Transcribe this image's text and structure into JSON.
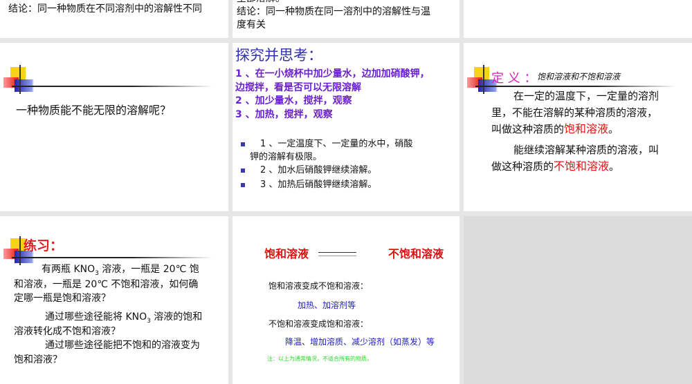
{
  "slides": {
    "s1": {
      "conclusion": "结论：同一种物质在不同溶剂中的溶解性不同"
    },
    "s2": {
      "partial_top": "全部溶解。",
      "conclusion_line1": "结论：同一种物质在同一溶剂中的溶解性与温",
      "conclusion_line2": "度有关"
    },
    "s4": {
      "question": "一种物质能不能无限的溶解呢？"
    },
    "s5": {
      "title": "探究并思考：",
      "steps": [
        "1 、在一小烧杯中加少量水，边加加硝酸钾，",
        "边搅拌，看是否可以无限溶解",
        "2 、加少量水，搅拌，观察",
        "3 、加热，搅拌，观察"
      ],
      "results": [
        "1 、一定温度下、一定量的水中，硝酸",
        "钾的溶解有极限。",
        "2 、加水后硝酸钾继续溶解。",
        "3 、加热后硝酸钾继续溶解。"
      ]
    },
    "s6": {
      "title": "定 义 ：",
      "subtitle": "饱和溶液和不饱和溶液",
      "p1_line1": "在一定的温度下，一定量的溶剂",
      "p1_line2": "里，不能在溶解的某种溶质的溶液，",
      "p1_line3_prefix": "叫做这种溶质的",
      "p1_highlight": "饱和溶液",
      "p1_end": "。",
      "p2_line1": "能继续溶解某种溶质的溶液，叫",
      "p2_line2_prefix": "做这种溶质的",
      "p2_highlight": "不饱和溶液",
      "p2_end": "。"
    },
    "s7": {
      "title": "练习：",
      "l1": "有两瓶 KNO",
      "l1_sub": "3",
      "l1_end": " 溶液，一瓶是 20℃ 饱",
      "l2": "和溶液，一瓶是 20℃ 不饱和溶液，如何确",
      "l3": "定哪一瓶是饱和溶液？",
      "l4": "通过哪些途径能将 KNO",
      "l4_sub": "3",
      "l4_end": " 溶液的饱和",
      "l5": "溶液转化成不饱和溶液？",
      "l6": "通过哪些途径能把不饱和的溶液变为",
      "l7": "饱和溶液？"
    },
    "s8": {
      "left": "饱和溶液",
      "right": "不饱和溶液",
      "h1": "饱和溶液变成不饱和溶液：",
      "a1": "加热、加溶剂等",
      "h2": "不饱和溶液变成饱和溶液：",
      "a2": "降温、增加溶质、减少溶剂（如蒸发）等",
      "note": "注：以上为通常情况，不适合所有的物质。"
    }
  },
  "colors": {
    "red": "#e01010",
    "blue": "#2020c0",
    "purple": "#6a1fd0",
    "green": "#22dd22"
  }
}
